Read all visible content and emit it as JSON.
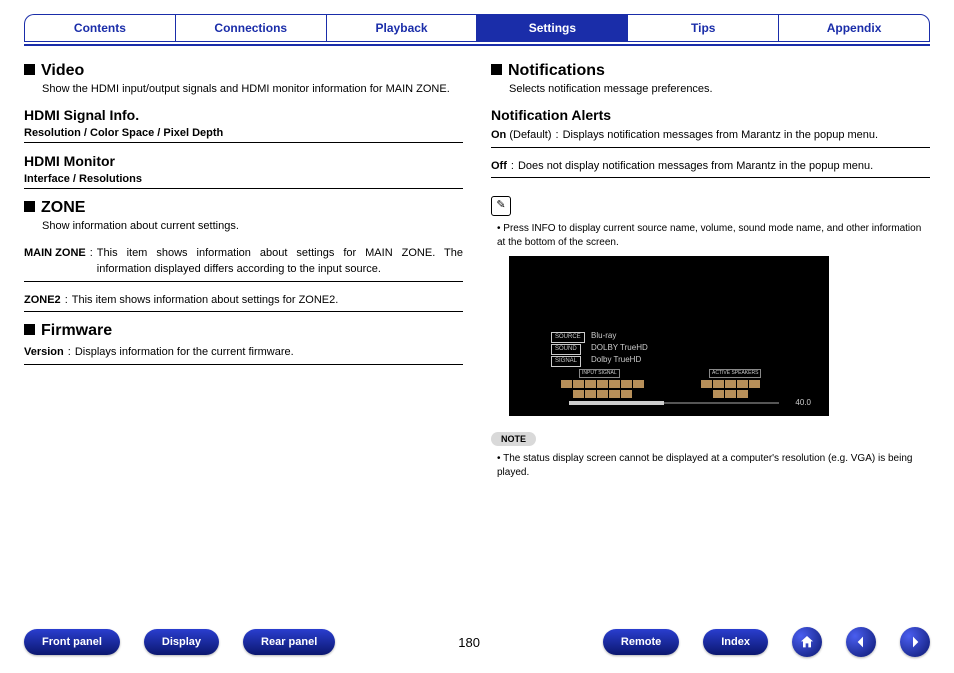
{
  "tabs": [
    "Contents",
    "Connections",
    "Playback",
    "Settings",
    "Tips",
    "Appendix"
  ],
  "active_tab": 3,
  "left": {
    "video": {
      "title": "Video",
      "desc": "Show the HDMI input/output signals and HDMI monitor information for MAIN ZONE.",
      "sig_title": "HDMI Signal Info.",
      "sig_sub": "Resolution / Color Space / Pixel Depth",
      "mon_title": "HDMI Monitor",
      "mon_sub": "Interface / Resolutions"
    },
    "zone": {
      "title": "ZONE",
      "desc": "Show information about current settings.",
      "rows": [
        {
          "k": "MAIN ZONE",
          "v": "This item shows information about settings for MAIN ZONE. The information displayed differs according to the input source."
        },
        {
          "k": "ZONE2",
          "v": "This item shows information about settings for ZONE2."
        }
      ]
    },
    "firmware": {
      "title": "Firmware",
      "rows": [
        {
          "k": "Version",
          "v": "Displays information for the current firmware."
        }
      ]
    }
  },
  "right": {
    "notif": {
      "title": "Notifications",
      "desc": "Selects notification message preferences.",
      "alerts_title": "Notification Alerts",
      "rows": [
        {
          "k": "On",
          "extra": " (Default)",
          "v": "Displays notification messages from Marantz in the popup menu."
        },
        {
          "k": "Off",
          "extra": "",
          "v": "Does not display notification messages from Marantz in the popup menu."
        }
      ]
    },
    "pencil_note": "Press INFO to display current source name, volume, sound mode name, and other information at the bottom of the screen.",
    "osd": {
      "source_label": "SOURCE",
      "source_val": "Blu-ray",
      "sound_label": "SOUND",
      "sound_val": "DOLBY TrueHD",
      "signal_label": "SIGNAL",
      "signal_val": "Dolby TrueHD",
      "in_label": "INPUT SIGNAL",
      "act_label": "ACTIVE SPEAKERS",
      "volume": "40.0"
    },
    "note_label": "NOTE",
    "note_text": "The status display screen cannot be displayed at a computer's resolution (e.g. VGA) is being played."
  },
  "footer": {
    "left": [
      "Front panel",
      "Display",
      "Rear panel"
    ],
    "page": "180",
    "right": [
      "Remote",
      "Index"
    ]
  }
}
